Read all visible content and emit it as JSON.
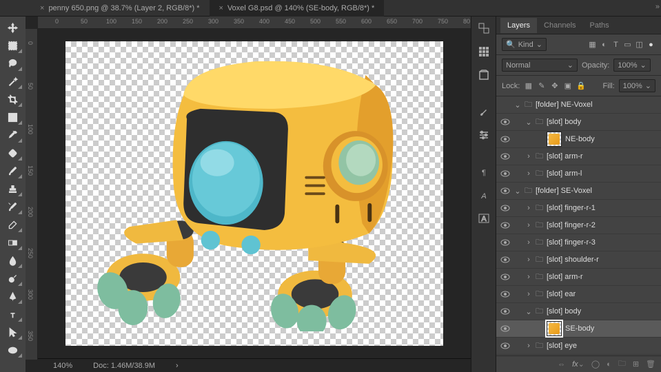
{
  "tabs": [
    {
      "label": "penny 650.png @ 38.7% (Layer 2, RGB/8*) *",
      "active": false
    },
    {
      "label": "Voxel G8.psd @ 140% (SE-body, RGB/8*) *",
      "active": true
    }
  ],
  "rulerH": [
    "0",
    "50",
    "100",
    "150",
    "200",
    "250",
    "300",
    "350",
    "400",
    "450",
    "500",
    "550",
    "600",
    "650",
    "700",
    "750",
    "80"
  ],
  "rulerV": [
    "0",
    "50",
    "100",
    "150",
    "200",
    "250",
    "300",
    "350"
  ],
  "status": {
    "zoom": "140%",
    "doc": "Doc: 1.46M/38.9M"
  },
  "panel": {
    "tabs": [
      "Layers",
      "Channels",
      "Paths"
    ],
    "filter": {
      "kind": "Kind"
    },
    "blend": {
      "mode": "Normal",
      "opacityLabel": "Opacity:",
      "opacity": "100%",
      "fillLabel": "Fill:",
      "fill": "100%",
      "lockLabel": "Lock:"
    },
    "layers": [
      {
        "indent": 0,
        "eye": false,
        "arrow": "v",
        "type": "folder",
        "name": "[folder] NE-Voxel"
      },
      {
        "indent": 1,
        "eye": true,
        "arrow": "v",
        "type": "folder",
        "name": "[slot] body"
      },
      {
        "indent": 2,
        "eye": true,
        "arrow": "",
        "type": "image",
        "name": "NE-body"
      },
      {
        "indent": 1,
        "eye": true,
        "arrow": ">",
        "type": "folder",
        "name": "[slot] arm-r"
      },
      {
        "indent": 1,
        "eye": true,
        "arrow": ">",
        "type": "folder",
        "name": "[slot] arm-l"
      },
      {
        "indent": 0,
        "eye": true,
        "arrow": "v",
        "type": "folder",
        "name": "[folder] SE-Voxel"
      },
      {
        "indent": 1,
        "eye": true,
        "arrow": ">",
        "type": "folder",
        "name": "[slot] finger-r-1"
      },
      {
        "indent": 1,
        "eye": true,
        "arrow": ">",
        "type": "folder",
        "name": "[slot] finger-r-2"
      },
      {
        "indent": 1,
        "eye": true,
        "arrow": ">",
        "type": "folder",
        "name": "[slot] finger-r-3"
      },
      {
        "indent": 1,
        "eye": true,
        "arrow": ">",
        "type": "folder",
        "name": "[slot] shoulder-r"
      },
      {
        "indent": 1,
        "eye": true,
        "arrow": ">",
        "type": "folder",
        "name": "[slot] arm-r"
      },
      {
        "indent": 1,
        "eye": true,
        "arrow": ">",
        "type": "folder",
        "name": "[slot] ear"
      },
      {
        "indent": 1,
        "eye": true,
        "arrow": "v",
        "type": "folder",
        "name": "[slot] body",
        "selected": false
      },
      {
        "indent": 2,
        "eye": true,
        "arrow": "",
        "type": "image",
        "name": "SE-body",
        "selected": true
      },
      {
        "indent": 1,
        "eye": true,
        "arrow": ">",
        "type": "folder",
        "name": "[slot] eye"
      }
    ]
  }
}
